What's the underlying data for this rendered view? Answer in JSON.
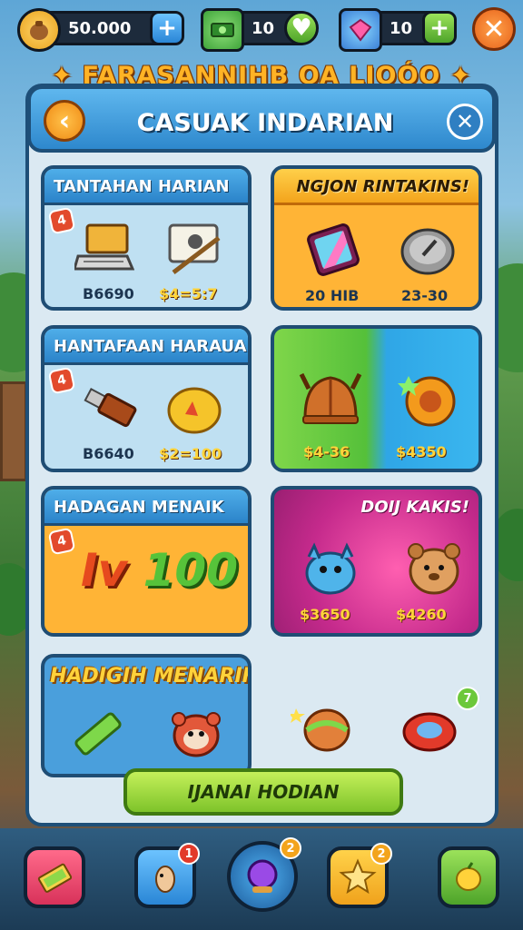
{
  "currency": {
    "coins": "50.000",
    "cash": "10",
    "gems": "10"
  },
  "main_title": "✦ FARASANNIHB OA LIOÓO ✦",
  "panel": {
    "title": "CASUAK INDARIAN"
  },
  "cards": {
    "card1": {
      "title": "TANTAHAN HARIAN",
      "badge": "4",
      "price_left": "B6690",
      "price_right": "$4=5:7"
    },
    "card2": {
      "title": "NGJON RINTAKINS!",
      "price_left": "20 HIB",
      "price_right": "23-30"
    },
    "card3": {
      "title": "HANTAFAAN HARAUAN",
      "badge": "4",
      "price_left": "B6640",
      "price_right": "$2=100"
    },
    "card4": {
      "price_left": "$4-36",
      "price_right": "$4350"
    },
    "card5": {
      "title": "HADAGAN MENAIK",
      "badge": "4",
      "promo_left": "Iv",
      "promo_right": "100"
    },
    "card6": {
      "title": "DOIJ KAKIS!",
      "price_left": "$3650",
      "price_right": "$4260"
    },
    "card7": {
      "title": "HADIGIH MENARIKS"
    },
    "extra_badge": "7"
  },
  "cta_label": "IJANAI HODIAN",
  "nav": {
    "badge_2": "1",
    "badge_3": "2",
    "badge_4": "2"
  },
  "colors": {
    "accent_orange": "#f08a14",
    "panel_blue": "#2e88cd",
    "cta_green": "#7ec42a"
  }
}
